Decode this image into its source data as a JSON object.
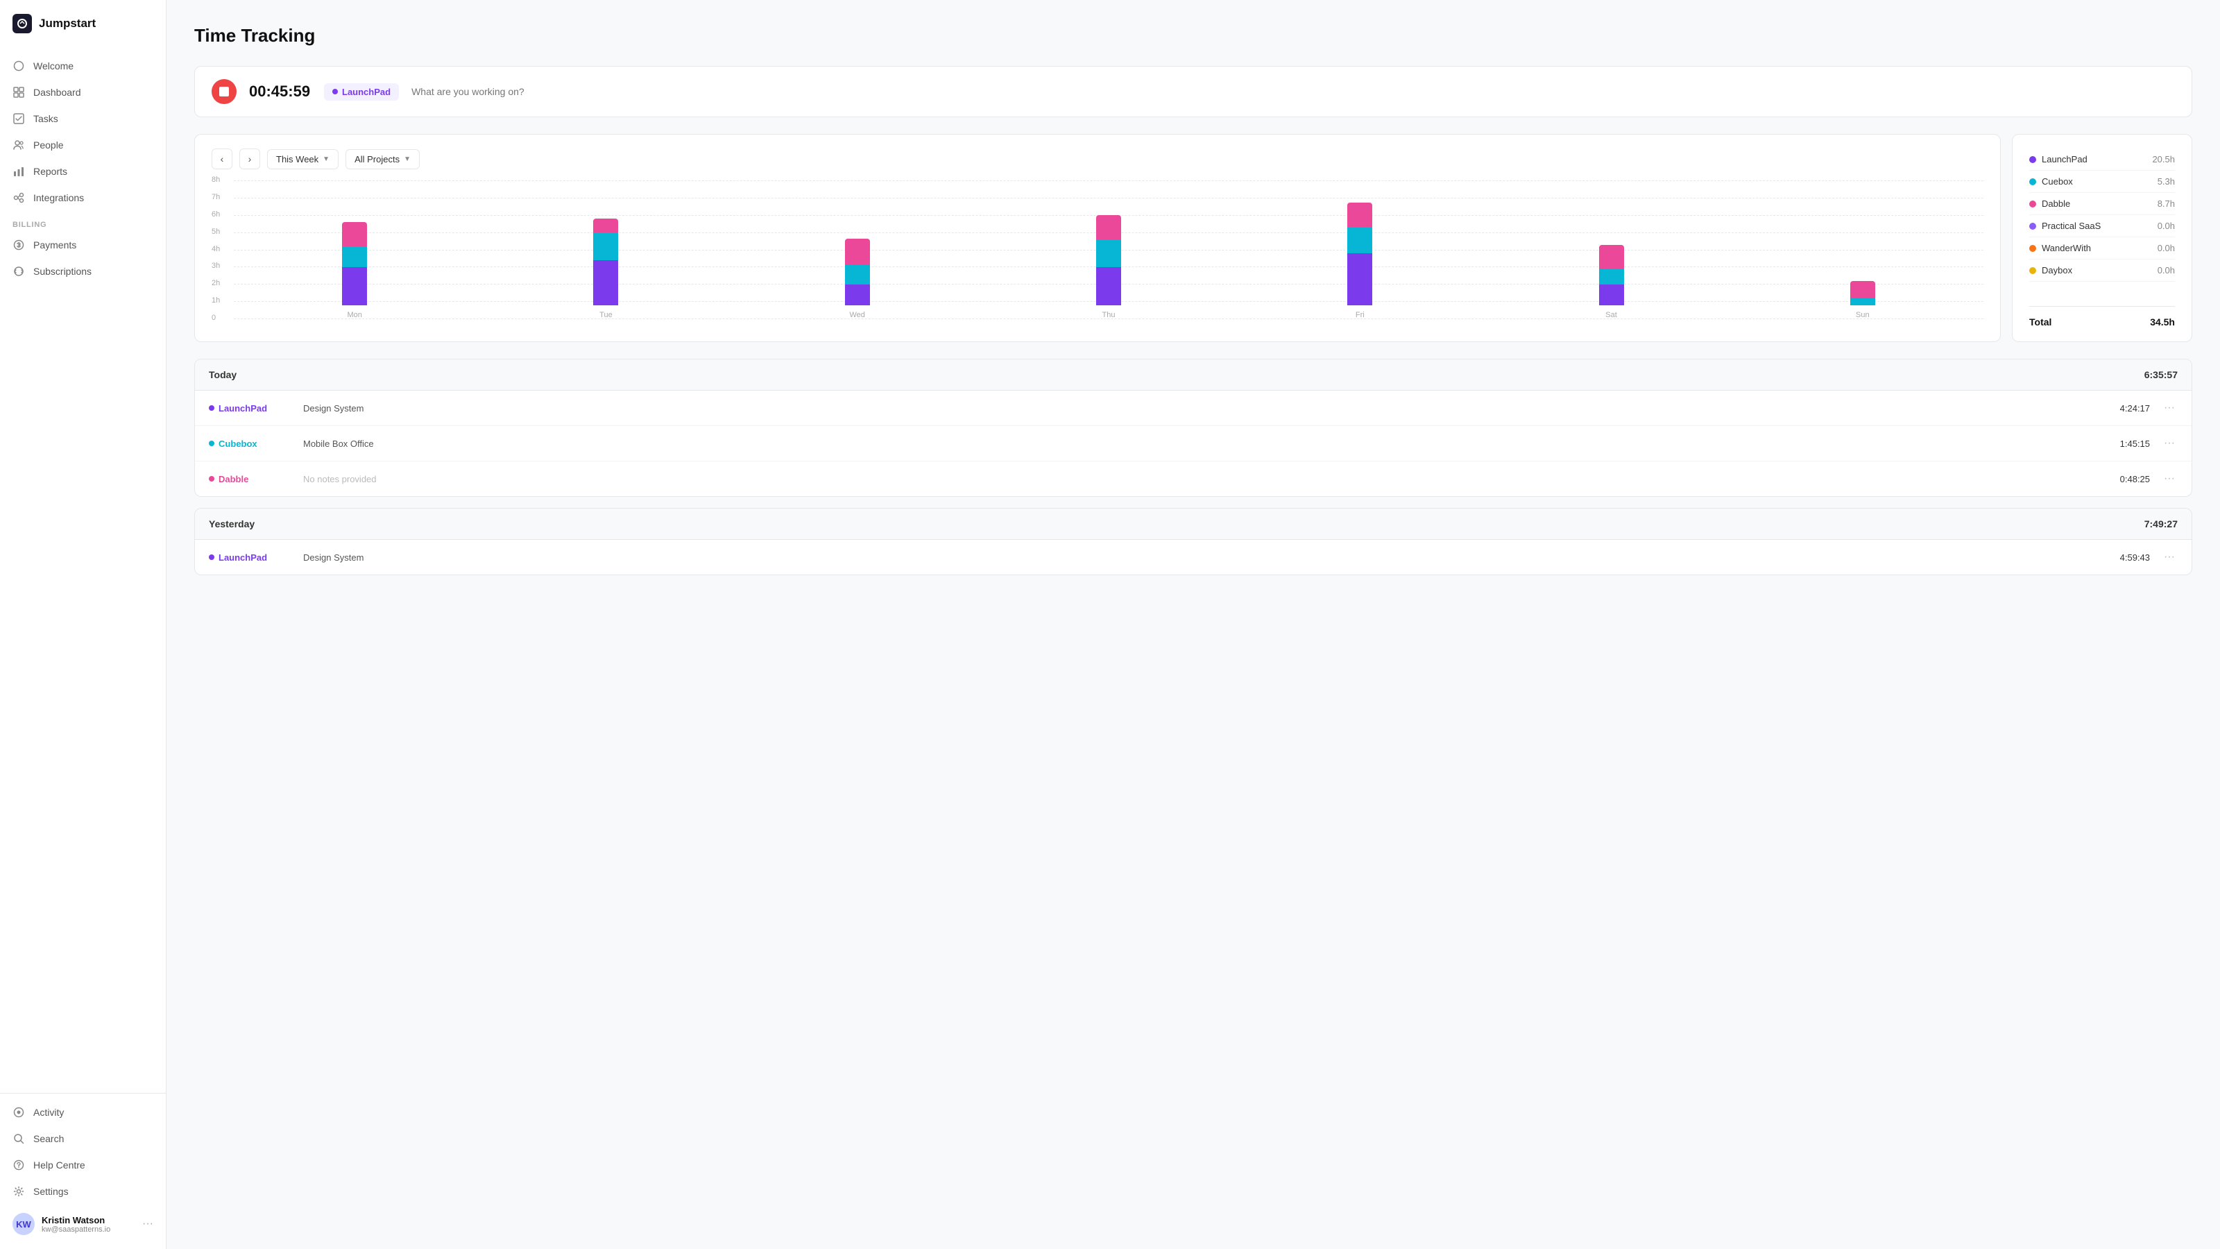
{
  "app": {
    "name": "Jumpstart"
  },
  "sidebar": {
    "nav_items": [
      {
        "id": "welcome",
        "label": "Welcome",
        "icon": "circle"
      },
      {
        "id": "dashboard",
        "label": "Dashboard",
        "icon": "grid"
      },
      {
        "id": "tasks",
        "label": "Tasks",
        "icon": "checkbox"
      },
      {
        "id": "people",
        "label": "People",
        "icon": "person"
      },
      {
        "id": "reports",
        "label": "Reports",
        "icon": "bar-chart"
      },
      {
        "id": "integrations",
        "label": "Integrations",
        "icon": "plug"
      }
    ],
    "billing_label": "BILLING",
    "billing_items": [
      {
        "id": "payments",
        "label": "Payments",
        "icon": "dollar"
      },
      {
        "id": "subscriptions",
        "label": "Subscriptions",
        "icon": "refresh"
      }
    ],
    "bottom_items": [
      {
        "id": "activity",
        "label": "Activity",
        "icon": "activity"
      },
      {
        "id": "search",
        "label": "Search",
        "icon": "search"
      },
      {
        "id": "help",
        "label": "Help Centre",
        "icon": "question"
      },
      {
        "id": "settings",
        "label": "Settings",
        "icon": "gear"
      }
    ],
    "user": {
      "name": "Kristin Watson",
      "email": "kw@saaspatterns.io",
      "initials": "KW"
    }
  },
  "page": {
    "title": "Time Tracking"
  },
  "timer": {
    "display": "00:45:59",
    "project": "LaunchPad",
    "project_color": "#7c3aed",
    "placeholder": "What are you working on?"
  },
  "chart": {
    "period_label": "This Week",
    "filter_label": "All Projects",
    "y_labels": [
      "8h",
      "7h",
      "6h",
      "5h",
      "4h",
      "3h",
      "2h",
      "1h",
      "0"
    ],
    "days": [
      {
        "label": "Mon",
        "segments": [
          {
            "color": "#7c3aed",
            "height": 55
          },
          {
            "color": "#06b6d4",
            "height": 30
          },
          {
            "color": "#ec4899",
            "height": 35
          }
        ]
      },
      {
        "label": "Tue",
        "segments": [
          {
            "color": "#7c3aed",
            "height": 65
          },
          {
            "color": "#06b6d4",
            "height": 40
          },
          {
            "color": "#ec4899",
            "height": 20
          }
        ]
      },
      {
        "label": "Wed",
        "segments": [
          {
            "color": "#7c3aed",
            "height": 30
          },
          {
            "color": "#06b6d4",
            "height": 28
          },
          {
            "color": "#ec4899",
            "height": 38
          }
        ]
      },
      {
        "label": "Thu",
        "segments": [
          {
            "color": "#7c3aed",
            "height": 55
          },
          {
            "color": "#06b6d4",
            "height": 40
          },
          {
            "color": "#ec4899",
            "height": 35
          }
        ]
      },
      {
        "label": "Fri",
        "segments": [
          {
            "color": "#7c3aed",
            "height": 75
          },
          {
            "color": "#06b6d4",
            "height": 38
          },
          {
            "color": "#ec4899",
            "height": 35
          }
        ]
      },
      {
        "label": "Sat",
        "segments": [
          {
            "color": "#7c3aed",
            "height": 30
          },
          {
            "color": "#06b6d4",
            "height": 22
          },
          {
            "color": "#ec4899",
            "height": 35
          }
        ]
      },
      {
        "label": "Sun",
        "segments": [
          {
            "color": "#7c3aed",
            "height": 0
          },
          {
            "color": "#06b6d4",
            "height": 10
          },
          {
            "color": "#ec4899",
            "height": 25
          }
        ]
      }
    ]
  },
  "legend": {
    "items": [
      {
        "name": "LaunchPad",
        "value": "20.5h",
        "color": "#7c3aed"
      },
      {
        "name": "Cuebox",
        "value": "5.3h",
        "color": "#06b6d4"
      },
      {
        "name": "Dabble",
        "value": "8.7h",
        "color": "#ec4899"
      },
      {
        "name": "Practical SaaS",
        "value": "0.0h",
        "color": "#8b5cf6"
      },
      {
        "name": "WanderWith",
        "value": "0.0h",
        "color": "#f97316"
      },
      {
        "name": "Daybox",
        "value": "0.0h",
        "color": "#eab308"
      }
    ],
    "total_label": "Total",
    "total_value": "34.5h"
  },
  "today": {
    "label": "Today",
    "total": "6:35:57",
    "entries": [
      {
        "project": "LaunchPad",
        "project_color": "#7c3aed",
        "description": "Design System",
        "time": "4:24:17",
        "has_notes": true
      },
      {
        "project": "Cubebox",
        "project_color": "#06b6d4",
        "description": "Mobile Box Office",
        "time": "1:45:15",
        "has_notes": true
      },
      {
        "project": "Dabble",
        "project_color": "#ec4899",
        "description": "No notes provided",
        "time": "0:48:25",
        "has_notes": false
      }
    ]
  },
  "yesterday": {
    "label": "Yesterday",
    "total": "7:49:27",
    "entries": [
      {
        "project": "LaunchPad",
        "project_color": "#7c3aed",
        "description": "Design System",
        "time": "4:59:43",
        "has_notes": true
      }
    ]
  }
}
